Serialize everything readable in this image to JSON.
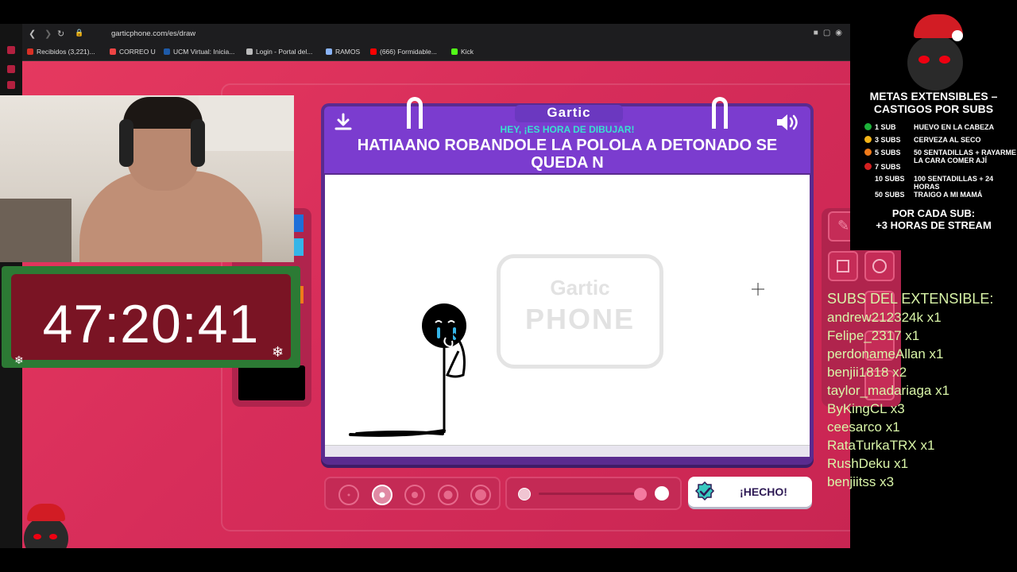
{
  "browser": {
    "url": "garticphone.com/es/draw",
    "bookmarks": [
      {
        "label": "Recibidos (3,221)...",
        "color": "#d93025"
      },
      {
        "label": "CORREO U",
        "color": "#e44"
      },
      {
        "label": "UCM Virtual: Inicia...",
        "color": "#1e5aa8"
      },
      {
        "label": "Login - Portal del...",
        "color": "#bbb"
      },
      {
        "label": "RAMOS",
        "color": "#8ab4f8"
      },
      {
        "label": "(666) Formidable...",
        "color": "#ff0000"
      },
      {
        "label": "Kick",
        "color": "#53fc18"
      }
    ]
  },
  "game": {
    "logo": "Gartic",
    "subtitle": "HEY, ¡ES HORA DE DIBUJAR!",
    "prompt": "HATIAANO ROBANDOLE LA POLOLA A DETONADO SE QUEDA N",
    "watermark_top": "Gartic",
    "watermark_bottom": "PHONE",
    "done_label": "¡HECHO!",
    "colors": {
      "card": "#5a2b8f",
      "header": "#7b3ccf",
      "accent": "#39e0d0",
      "page": "#d72d5a"
    }
  },
  "stream": {
    "timer": "47:20:41",
    "goals_title_line1": "METAS EXTENSIBLES –",
    "goals_title_line2": "CASTIGOS POR SUBS",
    "goals": [
      {
        "count": "1 SUB",
        "reward": "HUEVO EN LA CABEZA",
        "color": "#1db23a"
      },
      {
        "count": "3 SUBS",
        "reward": "CERVEZA AL SECO",
        "color": "#f3b418"
      },
      {
        "count": "5 SUBS",
        "reward": "50 SENTADILLAS + RAYARME LA CARA COMER AJÍ",
        "color": "#f07a1a"
      },
      {
        "count": "7 SUBS",
        "reward": "",
        "color": "#d42020"
      },
      {
        "count": "10 SUBS",
        "reward": "100 SENTADILLAS + 24 HORAS",
        "color": ""
      },
      {
        "count": "50 SUBS",
        "reward": "TRAIGO A MI MAMÁ",
        "color": ""
      }
    ],
    "footer_line1": "POR CADA SUB:",
    "footer_line2": "+3 HORAS DE STREAM",
    "subs_title": "SUBS DEL EXTENSIBLE:",
    "subs": [
      "andrew212324k x1",
      "Felipe_2317 x1",
      "perdonameAllan x1",
      "benjii1818 x2",
      "taylor_madariaga x1",
      "ByKingCL x3",
      "ceesarco x1",
      "RataTurkaTRX x1",
      "RushDeku x1",
      "benjiitss x3"
    ]
  }
}
